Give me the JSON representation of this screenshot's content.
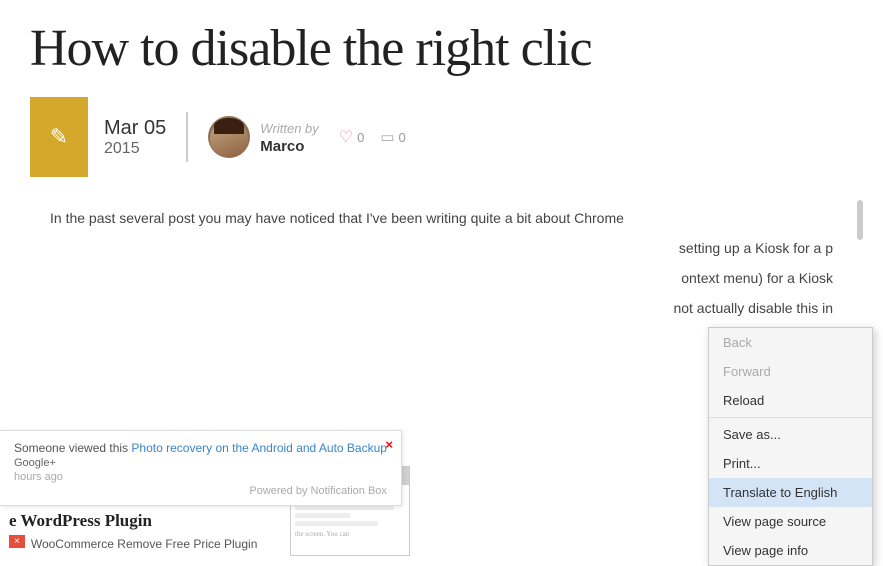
{
  "page": {
    "title": "How to disable the right clic",
    "date_main": "Mar 05",
    "date_year": "2015",
    "written_by": "Written by",
    "author": "Marco",
    "likes_count": "0",
    "comments_count": "0",
    "body_text": "In the past several post you may have noticed that I've been writing quite a bit about Chrome",
    "body_text2": "setting up a Kiosk for a p",
    "body_text3": "ontext menu) for a Kiosk",
    "body_text4": "not actually disable this in"
  },
  "notification": {
    "text_prefix": "Someone viewed this",
    "link_text": "Photo recovery on the Android and Auto Backup",
    "via": "Google+",
    "time": "hours ago",
    "powered": "Powered by Notification Box",
    "close_label": "×"
  },
  "plugin": {
    "title": "e WordPress Plugin",
    "close_label": "×",
    "badge_label": "×",
    "sub_label": "WooCommerce Remove Free Price Plugin"
  },
  "context_menu": {
    "items": [
      {
        "label": "Back",
        "disabled": true
      },
      {
        "label": "Forward",
        "disabled": true
      },
      {
        "label": "Reload",
        "disabled": false
      },
      {
        "label": "",
        "divider": true
      },
      {
        "label": "Save as...",
        "disabled": false
      },
      {
        "label": "Print...",
        "disabled": false
      },
      {
        "label": "Translate to English",
        "disabled": false,
        "highlighted": true
      },
      {
        "label": "View page source",
        "disabled": false
      },
      {
        "label": "View page info",
        "disabled": false
      }
    ]
  },
  "icons": {
    "pencil": "✎",
    "heart": "♡",
    "comment": "▭",
    "close_red": "✕"
  }
}
